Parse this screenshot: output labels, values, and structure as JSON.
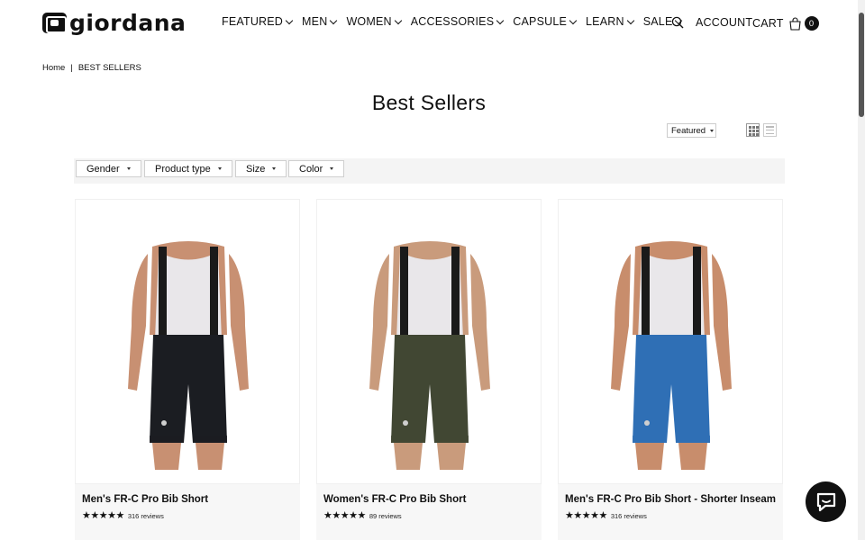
{
  "brand": {
    "name": "giordana"
  },
  "nav": [
    {
      "label": "FEATURED"
    },
    {
      "label": "MEN"
    },
    {
      "label": "WOMEN"
    },
    {
      "label": "ACCESSORIES"
    },
    {
      "label": "CAPSULE"
    },
    {
      "label": "LEARN"
    },
    {
      "label": "SALE"
    }
  ],
  "header": {
    "account_label": "ACCOUNT",
    "cart_label": "CART",
    "cart_count": "0"
  },
  "breadcrumb": {
    "home": "Home",
    "separator": "|",
    "current": "BEST SELLERS"
  },
  "page": {
    "title": "Best Sellers"
  },
  "sort": {
    "selected": "Featured"
  },
  "filters": [
    {
      "label": "Gender"
    },
    {
      "label": "Product type"
    },
    {
      "label": "Size"
    },
    {
      "label": "Color"
    }
  ],
  "products": [
    {
      "title": "Men's FR-C Pro Bib Short",
      "stars": "★★★★★",
      "reviews": "316 reviews",
      "short_color": "#1b1d22",
      "skin": "#c89072"
    },
    {
      "title": "Women's FR-C Pro Bib Short",
      "stars": "★★★★★",
      "reviews": "89 reviews",
      "short_color": "#414733",
      "skin": "#c99b7c"
    },
    {
      "title": "Men's FR-C Pro Bib Short - Shorter Inseam",
      "stars": "★★★★★",
      "reviews": "316 reviews",
      "short_color": "#2f6fb5",
      "skin": "#c88d6c"
    }
  ],
  "colors": {
    "text": "#111111",
    "filter_bar": "#f4f4f4",
    "card_info": "#f7f7f7"
  }
}
